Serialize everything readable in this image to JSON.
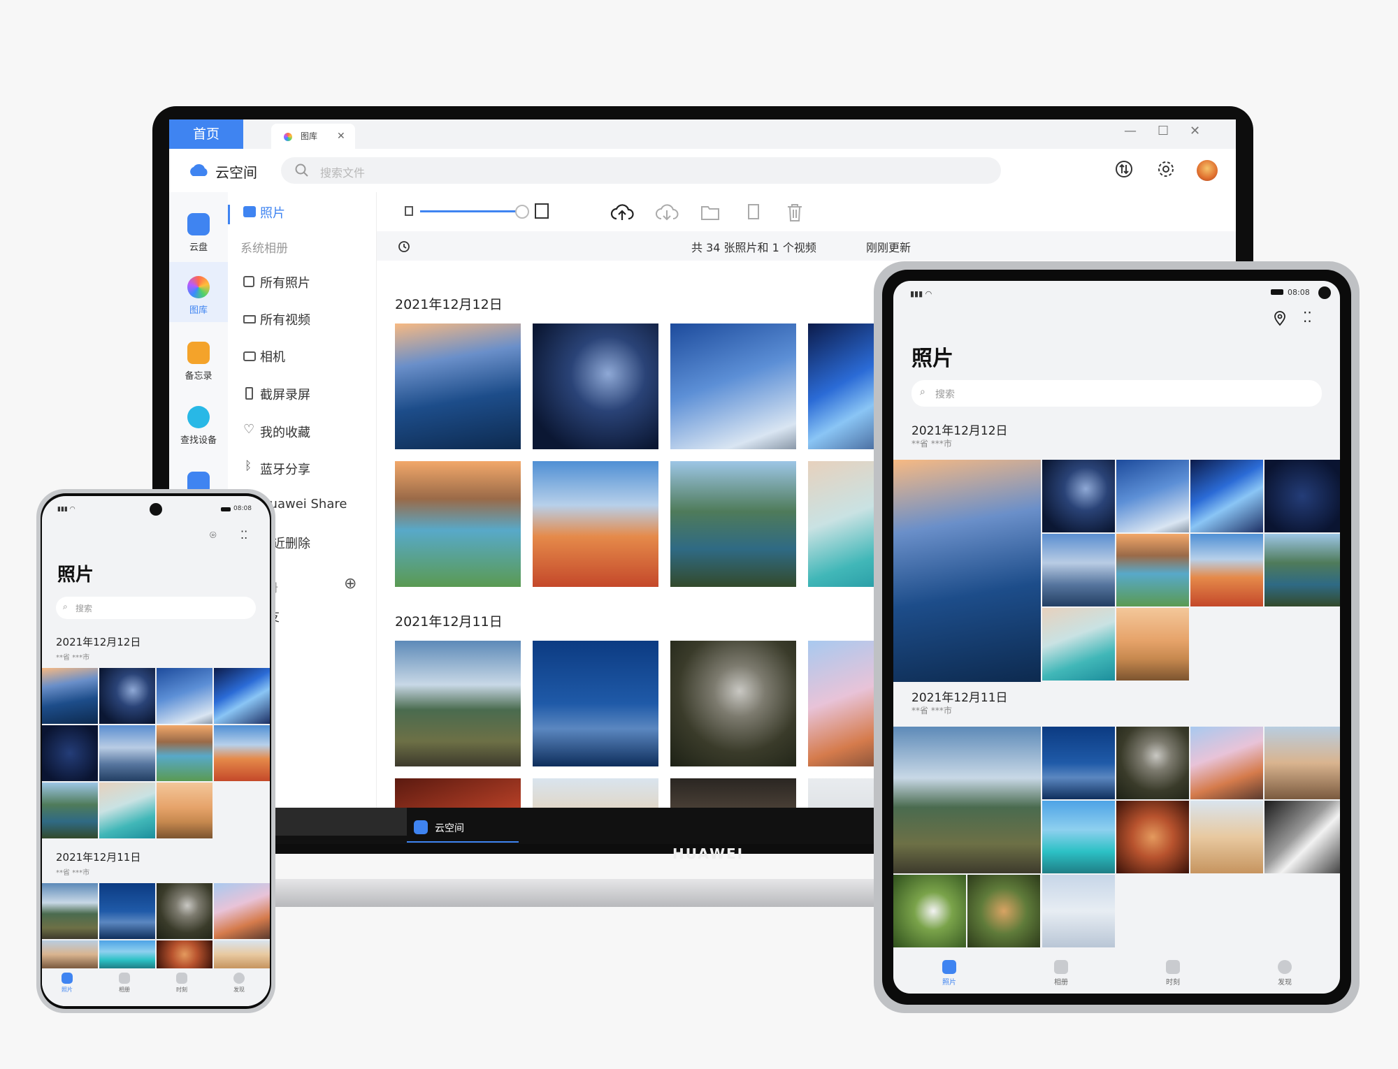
{
  "laptop": {
    "tabs": {
      "home": "首页",
      "gallery": "图库"
    },
    "app_name": "云空间",
    "search_placeholder": "搜索文件",
    "rail": [
      {
        "label": "云盘",
        "color": "#3f84f1"
      },
      {
        "label": "图库",
        "color": "#ff8a3d"
      },
      {
        "label": "备忘录",
        "color": "#f4a32a"
      },
      {
        "label": "查找设备",
        "color": "#28b8e6"
      }
    ],
    "sidebar": {
      "photos": "照片",
      "system_albums": "系统相册",
      "items": [
        "所有照片",
        "所有视频",
        "相机",
        "截屏录屏",
        "我的收藏",
        "蓝牙分享",
        "Huawei Share",
        "最近删除"
      ],
      "albums": "相册",
      "friends": "朋友"
    },
    "status": {
      "count": "共 34 张照片和 1 个视频",
      "updated": "刚刚更新"
    },
    "groups": [
      {
        "date": "2021年12月12日"
      },
      {
        "date": "2021年12月11日"
      }
    ],
    "taskbar_app": "云空间",
    "brand": "HUAWEI"
  },
  "tablet": {
    "time": "08:08",
    "title": "照片",
    "search": "搜索",
    "groups": [
      {
        "date": "2021年12月12日",
        "location": "**省 ***市"
      },
      {
        "date": "2021年12月11日",
        "location": "**省 ***市"
      }
    ],
    "nav": [
      "照片",
      "相册",
      "时刻",
      "发现"
    ]
  },
  "phone": {
    "time": "08:08",
    "title": "照片",
    "search": "搜索",
    "groups": [
      {
        "date": "2021年12月12日",
        "location": "**省 ***市"
      },
      {
        "date": "2021年12月11日",
        "location": "**省 ***市"
      }
    ],
    "nav": [
      "照片",
      "相册",
      "时刻",
      "发现"
    ]
  },
  "colors": {
    "accent": "#3f84f1"
  }
}
